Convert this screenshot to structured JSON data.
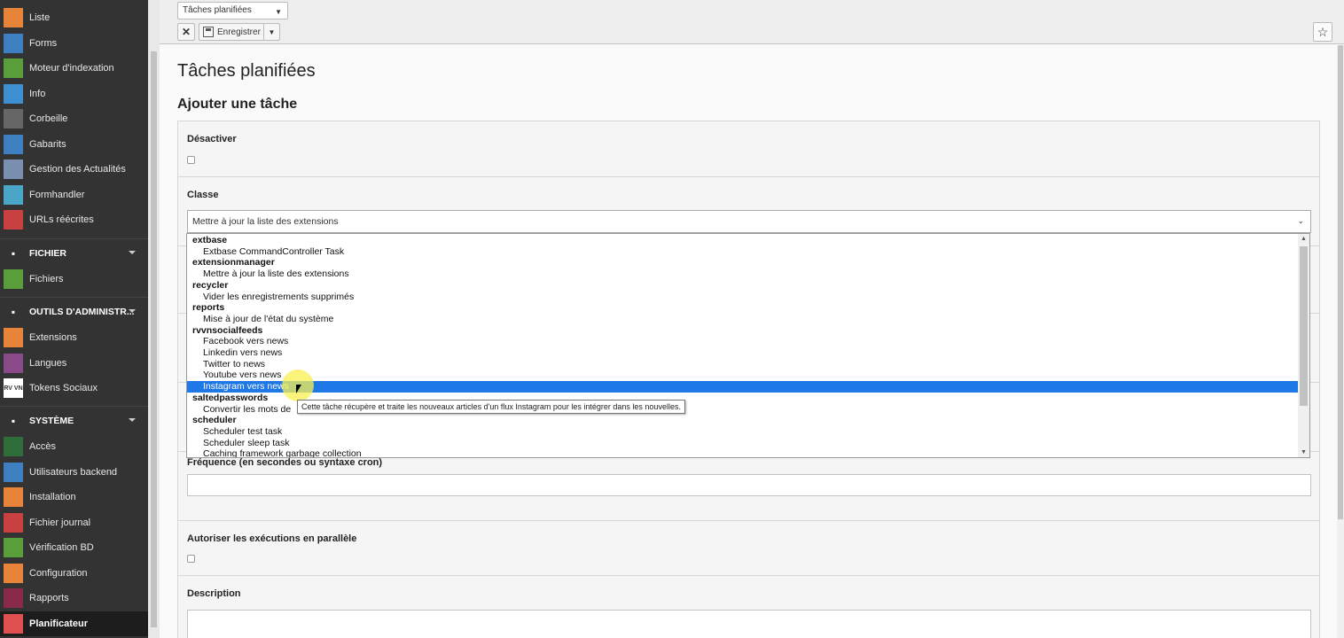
{
  "sidebar": {
    "web_items": [
      {
        "label": "Liste",
        "icon": "list-icon",
        "color": "#e8833a"
      },
      {
        "label": "Forms",
        "icon": "forms-icon",
        "color": "#3d7fc1"
      },
      {
        "label": "Moteur d'indexation",
        "icon": "indexer-icon",
        "color": "#5a9e3b"
      },
      {
        "label": "Info",
        "icon": "info-icon",
        "color": "#3d8fd1"
      },
      {
        "label": "Corbeille",
        "icon": "trash-icon",
        "color": "#666666"
      },
      {
        "label": "Gabarits",
        "icon": "template-icon",
        "color": "#3d7fc1"
      },
      {
        "label": "Gestion des Actualités",
        "icon": "news-icon",
        "color": "#7b8fb0"
      },
      {
        "label": "Formhandler",
        "icon": "formhandler-icon",
        "color": "#4aa6c8"
      },
      {
        "label": "URLs réécrites",
        "icon": "pill-icon",
        "color": "#c84040"
      }
    ],
    "file_section": {
      "label": "FICHIER",
      "icon": "image-icon"
    },
    "file_items": [
      {
        "label": "Fichiers",
        "icon": "folder-icon",
        "color": "#5a9e3b"
      }
    ],
    "admin_section": {
      "label": "OUTILS D'ADMINISTR...",
      "icon": "rocket-icon"
    },
    "admin_items": [
      {
        "label": "Extensions",
        "icon": "extension-icon",
        "color": "#e8833a"
      },
      {
        "label": "Langues",
        "icon": "globe-icon",
        "color": "#8a4a8a"
      },
      {
        "label": "Tokens Sociaux",
        "icon": "rvvn-icon",
        "color": "#ffffff"
      }
    ],
    "system_section": {
      "label": "SYSTÈME",
      "icon": "plug-icon"
    },
    "system_items": [
      {
        "label": "Accès",
        "icon": "lock-icon",
        "color": "#2f6e3a"
      },
      {
        "label": "Utilisateurs backend",
        "icon": "user-icon",
        "color": "#3d7fc1"
      },
      {
        "label": "Installation",
        "icon": "install-icon",
        "color": "#e8833a"
      },
      {
        "label": "Fichier journal",
        "icon": "log-icon",
        "color": "#c84040"
      },
      {
        "label": "Vérification BD",
        "icon": "db-check-icon",
        "color": "#5a9e3b"
      },
      {
        "label": "Configuration",
        "icon": "config-icon",
        "color": "#e8833a"
      },
      {
        "label": "Rapports",
        "icon": "reports-icon",
        "color": "#8a2a4a"
      },
      {
        "label": "Planificateur",
        "icon": "scheduler-icon",
        "color": "#e05050"
      }
    ]
  },
  "docheader": {
    "module_menu": "Tâches planifiées",
    "close_label": "✕",
    "save_label": "Enregistrer"
  },
  "main": {
    "title": "Tâches planifiées",
    "subtitle": "Ajouter une tâche",
    "fields": {
      "disable_label": "Désactiver",
      "class_label": "Classe",
      "class_value": "Mettre à jour la liste des extensions",
      "frequency_label": "Fréquence (en secondes ou syntaxe cron)",
      "parallel_label": "Autoriser les exécutions en parallèle",
      "description_label": "Description"
    }
  },
  "dropdown": {
    "rows": [
      {
        "type": "group",
        "label": "extbase"
      },
      {
        "type": "option",
        "label": "Extbase CommandController Task"
      },
      {
        "type": "group",
        "label": "extensionmanager"
      },
      {
        "type": "option",
        "label": "Mettre à jour la liste des extensions"
      },
      {
        "type": "group",
        "label": "recycler"
      },
      {
        "type": "option",
        "label": "Vider les enregistrements supprimés"
      },
      {
        "type": "group",
        "label": "reports"
      },
      {
        "type": "option",
        "label": "Mise à jour de l'état du système"
      },
      {
        "type": "group",
        "label": "rvvnsocialfeeds"
      },
      {
        "type": "option",
        "label": "Facebook vers news"
      },
      {
        "type": "option",
        "label": "Linkedin vers news"
      },
      {
        "type": "option",
        "label": "Twitter to news"
      },
      {
        "type": "option",
        "label": "Youtube vers news"
      },
      {
        "type": "option",
        "label": "Instagram vers news",
        "highlighted": true
      },
      {
        "type": "group",
        "label": "saltedpasswords"
      },
      {
        "type": "option",
        "label": "Convertir les mots de"
      },
      {
        "type": "group",
        "label": "scheduler"
      },
      {
        "type": "option",
        "label": "Scheduler test task"
      },
      {
        "type": "option",
        "label": "Scheduler sleep task"
      },
      {
        "type": "option",
        "label": "Caching framework garbage collection"
      }
    ],
    "tooltip": "Cette tâche récupère et traite les nouveaux articles d'un flux Instagram pour les intégrer dans les nouvelles."
  },
  "colors": {
    "sidebar_bg": "#333333",
    "highlight": "#1e78e6",
    "tooltip_border": "#767676"
  }
}
